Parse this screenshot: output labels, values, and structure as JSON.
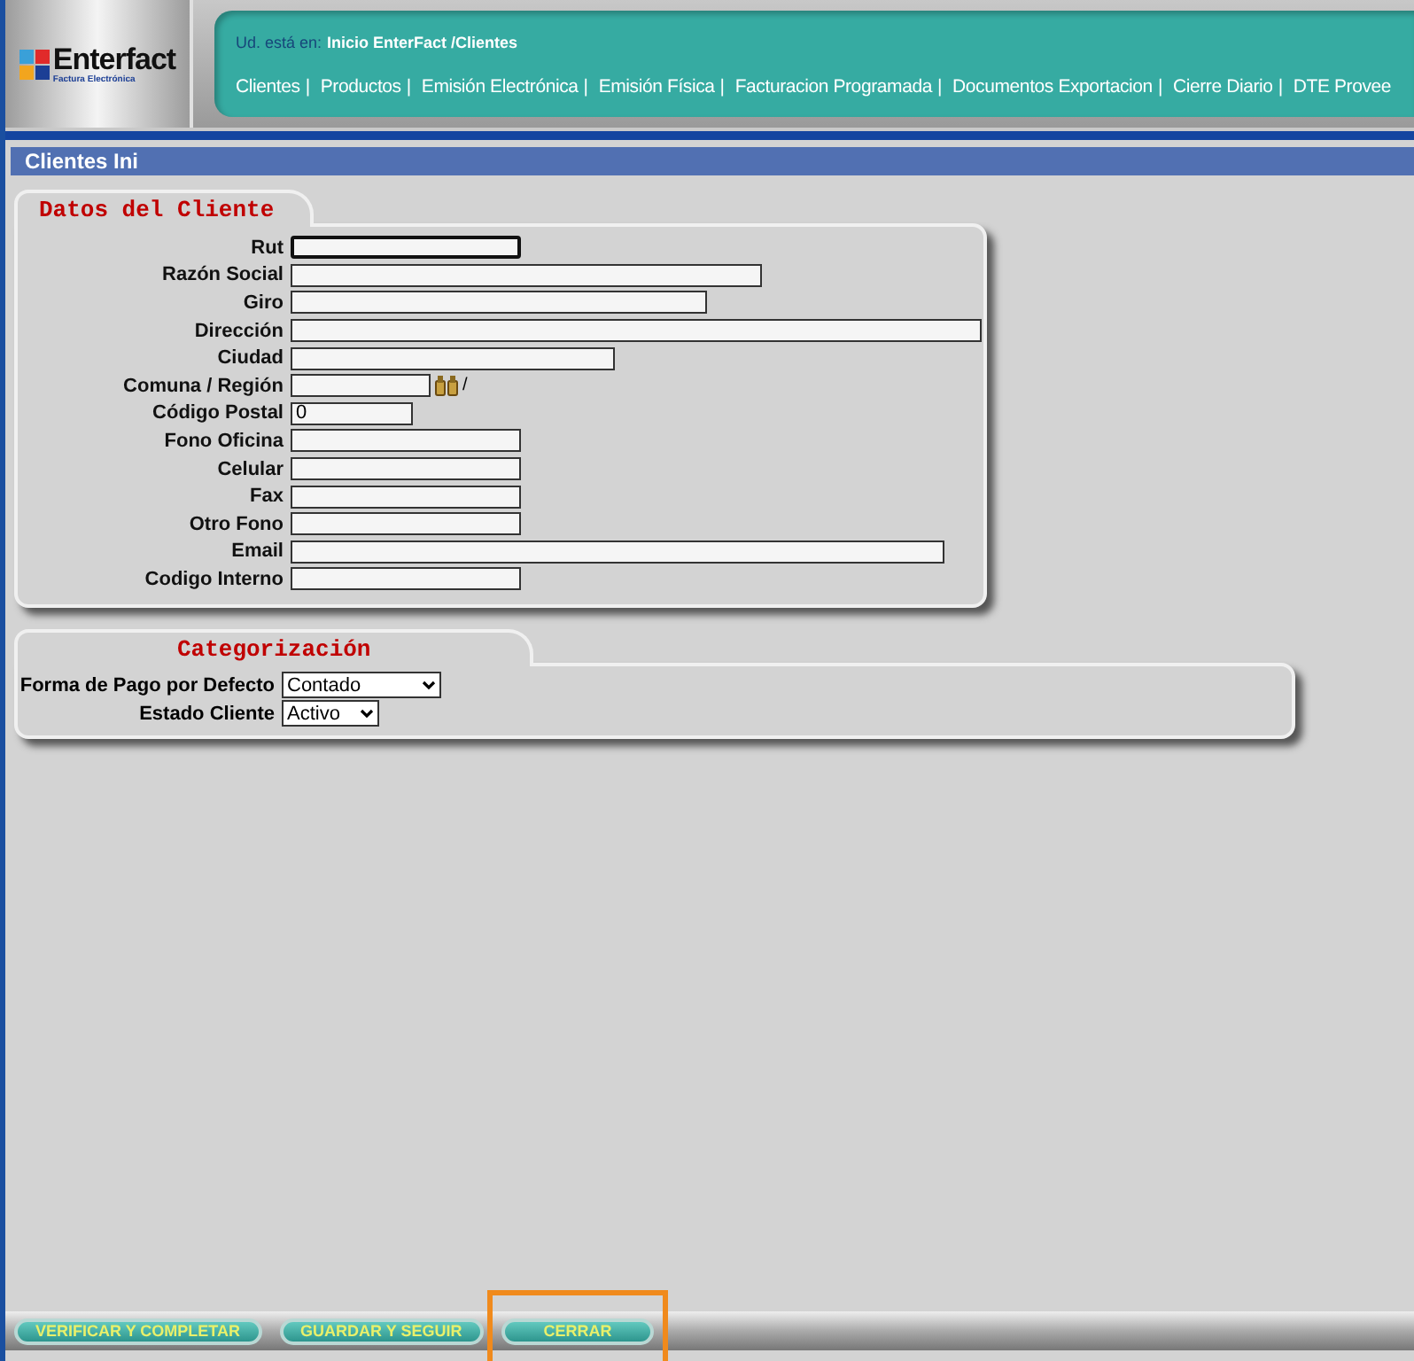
{
  "logo": {
    "name": "Enterfact",
    "tagline": "Factura Electrónica"
  },
  "breadcrumb": {
    "label": "Ud. está en:",
    "path": "Inicio EnterFact /Clientes"
  },
  "nav": [
    {
      "label": "Clientes",
      "separator": "|"
    },
    {
      "label": "Productos",
      "separator": "|"
    },
    {
      "label": "Emisión Electrónica",
      "separator": "|"
    },
    {
      "label": "Emisión Física",
      "separator": "|"
    },
    {
      "label": "Facturacion Programada",
      "separator": "|"
    },
    {
      "label": "Documentos Exportacion",
      "separator": "|"
    },
    {
      "label": "Cierre Diario",
      "separator": "|"
    },
    {
      "label": "DTE Provee"
    }
  ],
  "page_title": "Clientes Ini",
  "client_section": {
    "title": "Datos del Cliente",
    "fields": [
      {
        "label": "Rut",
        "focused": true
      },
      {
        "label": "Razón Social",
        "focused": false
      },
      {
        "label": "Giro",
        "focused": false
      },
      {
        "label": "Dirección",
        "focused": false
      },
      {
        "label": "Ciudad",
        "focused": false
      },
      {
        "label": "Comuna / Región",
        "focused": false,
        "kind": "lookup",
        "suffix": "/"
      },
      {
        "label": "Código Postal",
        "focused": false,
        "value": "0"
      },
      {
        "label": "Fono Oficina",
        "focused": false
      },
      {
        "label": "Celular",
        "focused": false
      },
      {
        "label": "Fax",
        "focused": false
      },
      {
        "label": "Otro Fono",
        "focused": false
      },
      {
        "label": "Email",
        "focused": false
      },
      {
        "label": "Codigo Interno",
        "focused": false
      }
    ]
  },
  "category_section": {
    "title": "Categorización",
    "fields": [
      {
        "label": "Forma de Pago por Defecto",
        "value": "Contado"
      },
      {
        "label": "Estado Cliente",
        "value": "Activo"
      }
    ]
  },
  "buttons": [
    {
      "label": "VERIFICAR Y COMPLETAR",
      "highlighted": false
    },
    {
      "label": "GUARDAR Y SEGUIR",
      "highlighted": false
    },
    {
      "label": "CERRAR",
      "highlighted": true
    }
  ]
}
